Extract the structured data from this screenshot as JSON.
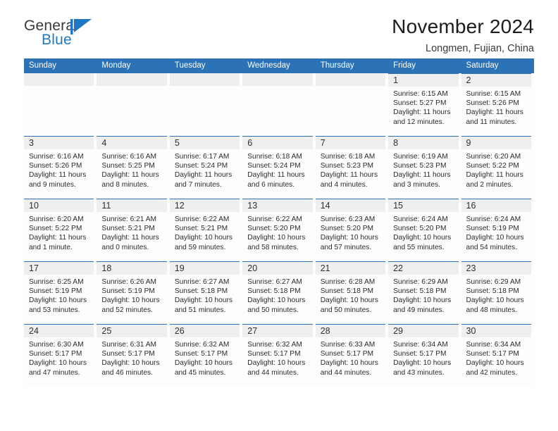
{
  "brand": {
    "name_top": "General",
    "name_bottom": "Blue",
    "mark": "flag-triangle-icon",
    "color_primary": "#2077c4",
    "color_header": "#2b72b6"
  },
  "header": {
    "title": "November 2024",
    "subtitle": "Longmen, Fujian, China"
  },
  "calendar": {
    "weekday_headers": [
      "Sunday",
      "Monday",
      "Tuesday",
      "Wednesday",
      "Thursday",
      "Friday",
      "Saturday"
    ],
    "weeks": [
      [
        {
          "day": "",
          "empty": true
        },
        {
          "day": "",
          "empty": true
        },
        {
          "day": "",
          "empty": true
        },
        {
          "day": "",
          "empty": true
        },
        {
          "day": "",
          "empty": true
        },
        {
          "day": "1",
          "sunrise": "Sunrise: 6:15 AM",
          "sunset": "Sunset: 5:27 PM",
          "daylight": "Daylight: 11 hours and 12 minutes."
        },
        {
          "day": "2",
          "sunrise": "Sunrise: 6:15 AM",
          "sunset": "Sunset: 5:26 PM",
          "daylight": "Daylight: 11 hours and 11 minutes."
        }
      ],
      [
        {
          "day": "3",
          "sunrise": "Sunrise: 6:16 AM",
          "sunset": "Sunset: 5:26 PM",
          "daylight": "Daylight: 11 hours and 9 minutes."
        },
        {
          "day": "4",
          "sunrise": "Sunrise: 6:16 AM",
          "sunset": "Sunset: 5:25 PM",
          "daylight": "Daylight: 11 hours and 8 minutes."
        },
        {
          "day": "5",
          "sunrise": "Sunrise: 6:17 AM",
          "sunset": "Sunset: 5:24 PM",
          "daylight": "Daylight: 11 hours and 7 minutes."
        },
        {
          "day": "6",
          "sunrise": "Sunrise: 6:18 AM",
          "sunset": "Sunset: 5:24 PM",
          "daylight": "Daylight: 11 hours and 6 minutes."
        },
        {
          "day": "7",
          "sunrise": "Sunrise: 6:18 AM",
          "sunset": "Sunset: 5:23 PM",
          "daylight": "Daylight: 11 hours and 4 minutes."
        },
        {
          "day": "8",
          "sunrise": "Sunrise: 6:19 AM",
          "sunset": "Sunset: 5:23 PM",
          "daylight": "Daylight: 11 hours and 3 minutes."
        },
        {
          "day": "9",
          "sunrise": "Sunrise: 6:20 AM",
          "sunset": "Sunset: 5:22 PM",
          "daylight": "Daylight: 11 hours and 2 minutes."
        }
      ],
      [
        {
          "day": "10",
          "sunrise": "Sunrise: 6:20 AM",
          "sunset": "Sunset: 5:22 PM",
          "daylight": "Daylight: 11 hours and 1 minute."
        },
        {
          "day": "11",
          "sunrise": "Sunrise: 6:21 AM",
          "sunset": "Sunset: 5:21 PM",
          "daylight": "Daylight: 11 hours and 0 minutes."
        },
        {
          "day": "12",
          "sunrise": "Sunrise: 6:22 AM",
          "sunset": "Sunset: 5:21 PM",
          "daylight": "Daylight: 10 hours and 59 minutes."
        },
        {
          "day": "13",
          "sunrise": "Sunrise: 6:22 AM",
          "sunset": "Sunset: 5:20 PM",
          "daylight": "Daylight: 10 hours and 58 minutes."
        },
        {
          "day": "14",
          "sunrise": "Sunrise: 6:23 AM",
          "sunset": "Sunset: 5:20 PM",
          "daylight": "Daylight: 10 hours and 57 minutes."
        },
        {
          "day": "15",
          "sunrise": "Sunrise: 6:24 AM",
          "sunset": "Sunset: 5:20 PM",
          "daylight": "Daylight: 10 hours and 55 minutes."
        },
        {
          "day": "16",
          "sunrise": "Sunrise: 6:24 AM",
          "sunset": "Sunset: 5:19 PM",
          "daylight": "Daylight: 10 hours and 54 minutes."
        }
      ],
      [
        {
          "day": "17",
          "sunrise": "Sunrise: 6:25 AM",
          "sunset": "Sunset: 5:19 PM",
          "daylight": "Daylight: 10 hours and 53 minutes."
        },
        {
          "day": "18",
          "sunrise": "Sunrise: 6:26 AM",
          "sunset": "Sunset: 5:19 PM",
          "daylight": "Daylight: 10 hours and 52 minutes."
        },
        {
          "day": "19",
          "sunrise": "Sunrise: 6:27 AM",
          "sunset": "Sunset: 5:18 PM",
          "daylight": "Daylight: 10 hours and 51 minutes."
        },
        {
          "day": "20",
          "sunrise": "Sunrise: 6:27 AM",
          "sunset": "Sunset: 5:18 PM",
          "daylight": "Daylight: 10 hours and 50 minutes."
        },
        {
          "day": "21",
          "sunrise": "Sunrise: 6:28 AM",
          "sunset": "Sunset: 5:18 PM",
          "daylight": "Daylight: 10 hours and 50 minutes."
        },
        {
          "day": "22",
          "sunrise": "Sunrise: 6:29 AM",
          "sunset": "Sunset: 5:18 PM",
          "daylight": "Daylight: 10 hours and 49 minutes."
        },
        {
          "day": "23",
          "sunrise": "Sunrise: 6:29 AM",
          "sunset": "Sunset: 5:18 PM",
          "daylight": "Daylight: 10 hours and 48 minutes."
        }
      ],
      [
        {
          "day": "24",
          "sunrise": "Sunrise: 6:30 AM",
          "sunset": "Sunset: 5:17 PM",
          "daylight": "Daylight: 10 hours and 47 minutes."
        },
        {
          "day": "25",
          "sunrise": "Sunrise: 6:31 AM",
          "sunset": "Sunset: 5:17 PM",
          "daylight": "Daylight: 10 hours and 46 minutes."
        },
        {
          "day": "26",
          "sunrise": "Sunrise: 6:32 AM",
          "sunset": "Sunset: 5:17 PM",
          "daylight": "Daylight: 10 hours and 45 minutes."
        },
        {
          "day": "27",
          "sunrise": "Sunrise: 6:32 AM",
          "sunset": "Sunset: 5:17 PM",
          "daylight": "Daylight: 10 hours and 44 minutes."
        },
        {
          "day": "28",
          "sunrise": "Sunrise: 6:33 AM",
          "sunset": "Sunset: 5:17 PM",
          "daylight": "Daylight: 10 hours and 44 minutes."
        },
        {
          "day": "29",
          "sunrise": "Sunrise: 6:34 AM",
          "sunset": "Sunset: 5:17 PM",
          "daylight": "Daylight: 10 hours and 43 minutes."
        },
        {
          "day": "30",
          "sunrise": "Sunrise: 6:34 AM",
          "sunset": "Sunset: 5:17 PM",
          "daylight": "Daylight: 10 hours and 42 minutes."
        }
      ]
    ]
  }
}
